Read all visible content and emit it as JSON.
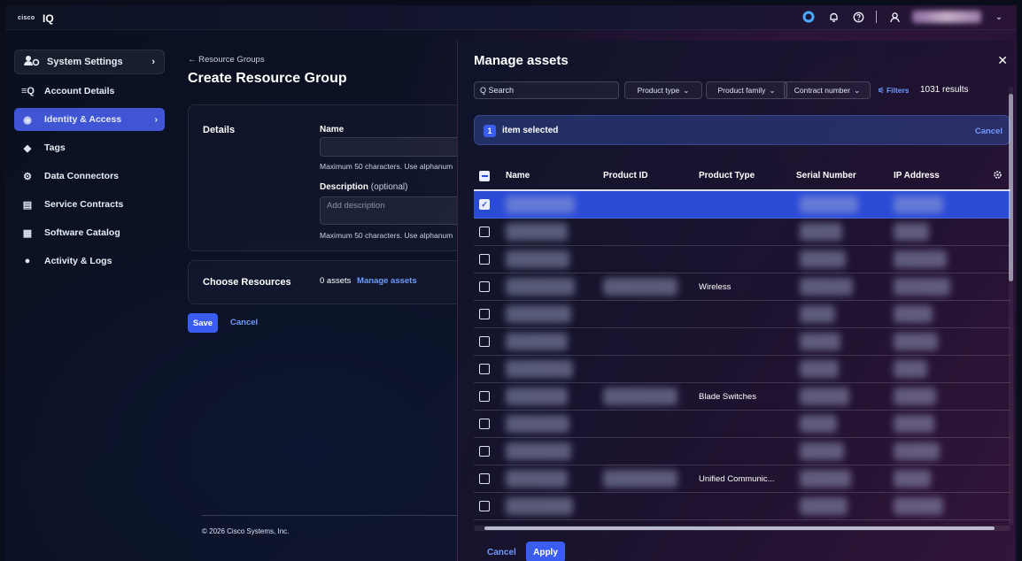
{
  "app": {
    "logo_mark": "cisco",
    "name": "IQ"
  },
  "topbar": {
    "icons": [
      "sync-icon",
      "bell-icon",
      "help-icon",
      "user-icon",
      "chevron-down-icon"
    ]
  },
  "sidebar": {
    "header": {
      "label": "System Settings",
      "chevron": "›"
    },
    "items": [
      {
        "label": "Account Details",
        "icon": "≡Q"
      },
      {
        "label": "Identity & Access",
        "icon": "◉",
        "active": true,
        "chevron": "›"
      },
      {
        "label": "Tags",
        "icon": "◆"
      },
      {
        "label": "Data Connectors",
        "icon": "⚙"
      },
      {
        "label": "Service Contracts",
        "icon": "▤"
      },
      {
        "label": "Software Catalog",
        "icon": "▦"
      },
      {
        "label": "Activity & Logs",
        "icon": "●"
      }
    ]
  },
  "main": {
    "breadcrumb": "← Resource Groups",
    "title": "Create Resource Group",
    "details": {
      "heading": "Details",
      "name_label": "Name",
      "name_hint": "Maximum 50 characters. Use alphanum",
      "desc_label": "Description",
      "desc_optional": "(optional)",
      "desc_placeholder": "Add description",
      "desc_hint": "Maximum 50 characters. Use alphanum"
    },
    "resources": {
      "heading": "Choose Resources",
      "count": "0 assets",
      "link": "Manage assets"
    },
    "save": "Save",
    "cancel": "Cancel",
    "copyright": "© 2026 Cisco Systems, Inc."
  },
  "modal": {
    "title": "Manage assets",
    "close": "✕",
    "search_placeholder": "Q Search",
    "filters": [
      {
        "label": "Product type"
      },
      {
        "label": "Product family"
      },
      {
        "label": "Contract number"
      }
    ],
    "filters_link": "⚟ Filters",
    "results": "1031 results",
    "selection": {
      "count": "1",
      "text": "item selected",
      "cancel": "Cancel"
    },
    "columns": [
      "Name",
      "Product ID",
      "Product Type",
      "Serial Number",
      "IP Address"
    ],
    "rows": [
      {
        "checked": true,
        "product_type": ""
      },
      {
        "checked": false,
        "product_type": ""
      },
      {
        "checked": false,
        "product_type": ""
      },
      {
        "checked": false,
        "product_type": "Wireless"
      },
      {
        "checked": false,
        "product_type": ""
      },
      {
        "checked": false,
        "product_type": ""
      },
      {
        "checked": false,
        "product_type": ""
      },
      {
        "checked": false,
        "product_type": "Blade Switches"
      },
      {
        "checked": false,
        "product_type": ""
      },
      {
        "checked": false,
        "product_type": ""
      },
      {
        "checked": false,
        "product_type": "Unified Communic..."
      },
      {
        "checked": false,
        "product_type": ""
      }
    ],
    "cancel": "Cancel",
    "apply": "Apply"
  },
  "colors": {
    "accent": "#3b5cf0",
    "link": "#6e9bff",
    "selected_row": "#2a4bd6"
  }
}
